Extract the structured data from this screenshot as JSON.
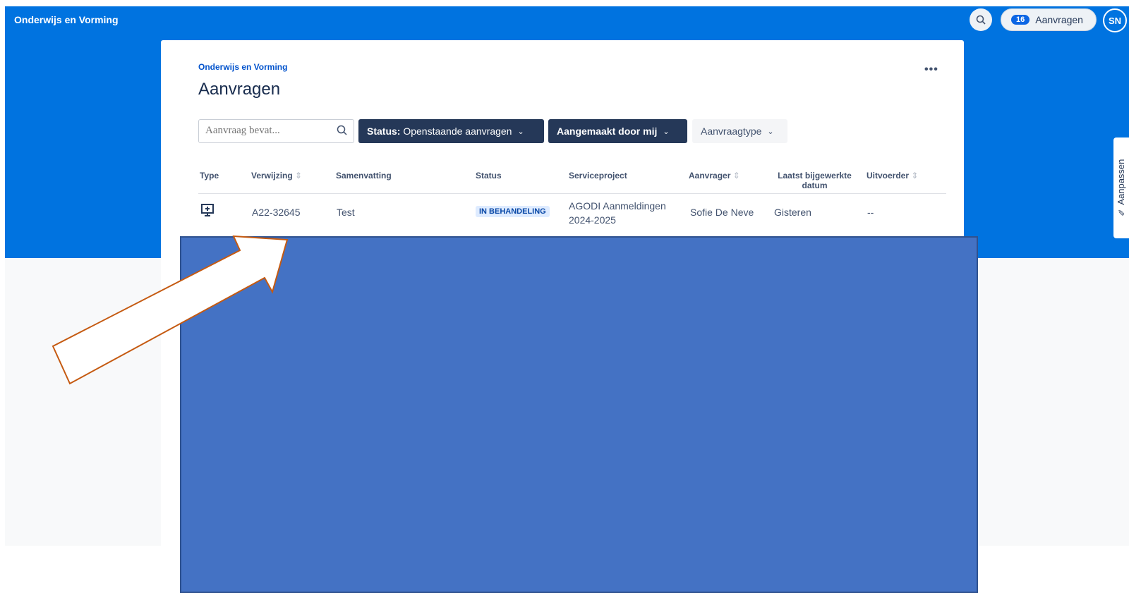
{
  "header": {
    "brand": "Onderwijs en Vorming",
    "requests_count": "16",
    "requests_label": "Aanvragen",
    "avatar_initials": "SN",
    "search_icon": "search-icon"
  },
  "side_tab": {
    "label": "Aanpassen",
    "icon": "pencil-icon"
  },
  "page": {
    "breadcrumb": "Onderwijs en Vorming",
    "title": "Aanvragen",
    "more_label": "•••"
  },
  "filters": {
    "search_placeholder": "Aanvraag bevat...",
    "status_label": "Status:",
    "status_value": "Openstaande aanvragen",
    "created_by": "Aangemaakt door mij",
    "request_type": "Aanvraagtype"
  },
  "table": {
    "headers": {
      "type": "Type",
      "reference": "Verwijzing",
      "summary": "Samenvatting",
      "status": "Status",
      "project": "Serviceproject",
      "requester": "Aanvrager",
      "updated_line1": "Laatst bijgewerkte",
      "updated_line2": "datum",
      "assignee": "Uitvoerder"
    },
    "rows": [
      {
        "type_icon": "desktop-plus-icon",
        "reference": "A22-32645",
        "summary": "Test",
        "status": "IN BEHANDELING",
        "project_line1": "AGODI Aanmeldingen",
        "project_line2": "2024-2025",
        "requester": "Sofie De Neve",
        "updated": "Gisteren",
        "assignee": "--"
      }
    ]
  },
  "colors": {
    "header_blue": "#0073e0",
    "overlay_blue": "#4472c4",
    "arrow_outline": "#c55a11",
    "dark_filter": "#253858"
  }
}
